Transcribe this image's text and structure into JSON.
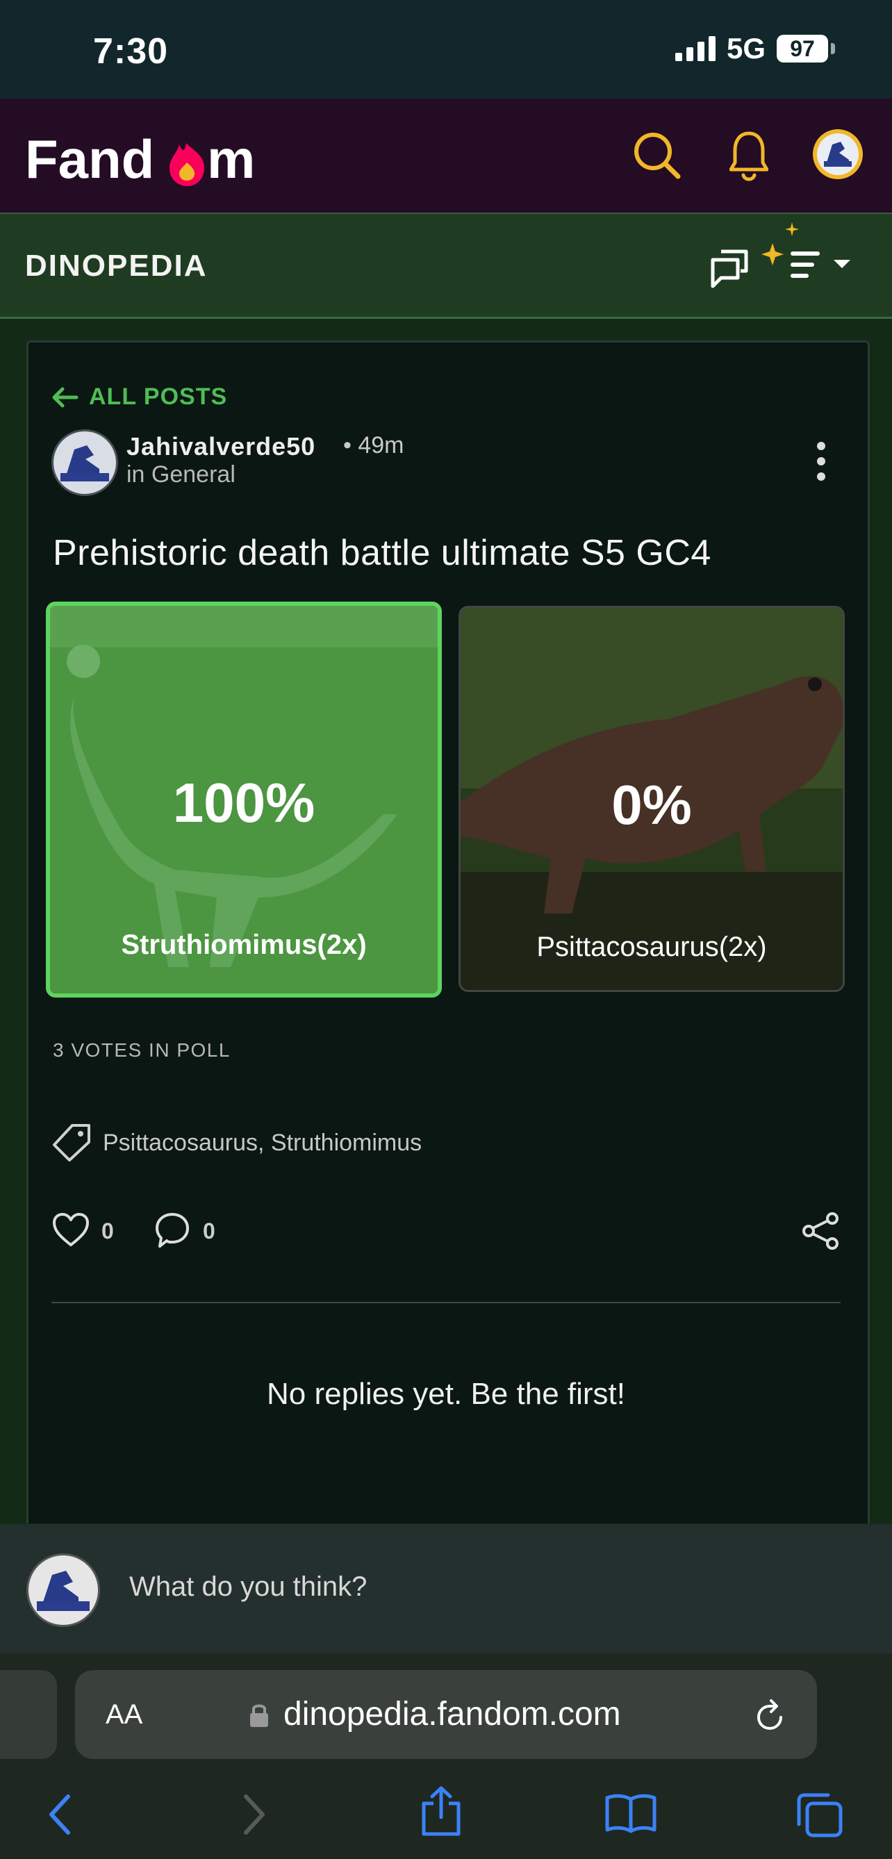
{
  "status_bar": {
    "time": "7:30",
    "network": "5G",
    "battery": "97"
  },
  "header": {
    "logo_text": "Fandom"
  },
  "wiki": {
    "name": "DINOPEDIA"
  },
  "post": {
    "back_label": "ALL POSTS",
    "author": "Jahivalverde50",
    "time": "• 49m",
    "category": "in General",
    "title": "Prehistoric death battle ultimate S5 GC4",
    "poll": {
      "options": [
        {
          "percent": "100%",
          "label": "Struthiomimus(2x)",
          "selected": true
        },
        {
          "percent": "0%",
          "label": "Psittacosaurus(2x)",
          "selected": false
        }
      ],
      "votes": "3 VOTES IN POLL"
    },
    "tags": "Psittacosaurus, Struthiomimus",
    "likes": "0",
    "replies": "0",
    "empty_replies": "No replies yet. Be the first!"
  },
  "composer": {
    "placeholder": "What do you think?"
  },
  "browser": {
    "text_size": "AA",
    "url": "dinopedia.fandom.com"
  },
  "colors": {
    "accent_green": "#4fbd54",
    "fandom_yellow": "#f1b728",
    "fandom_pink": "#fa005a"
  }
}
